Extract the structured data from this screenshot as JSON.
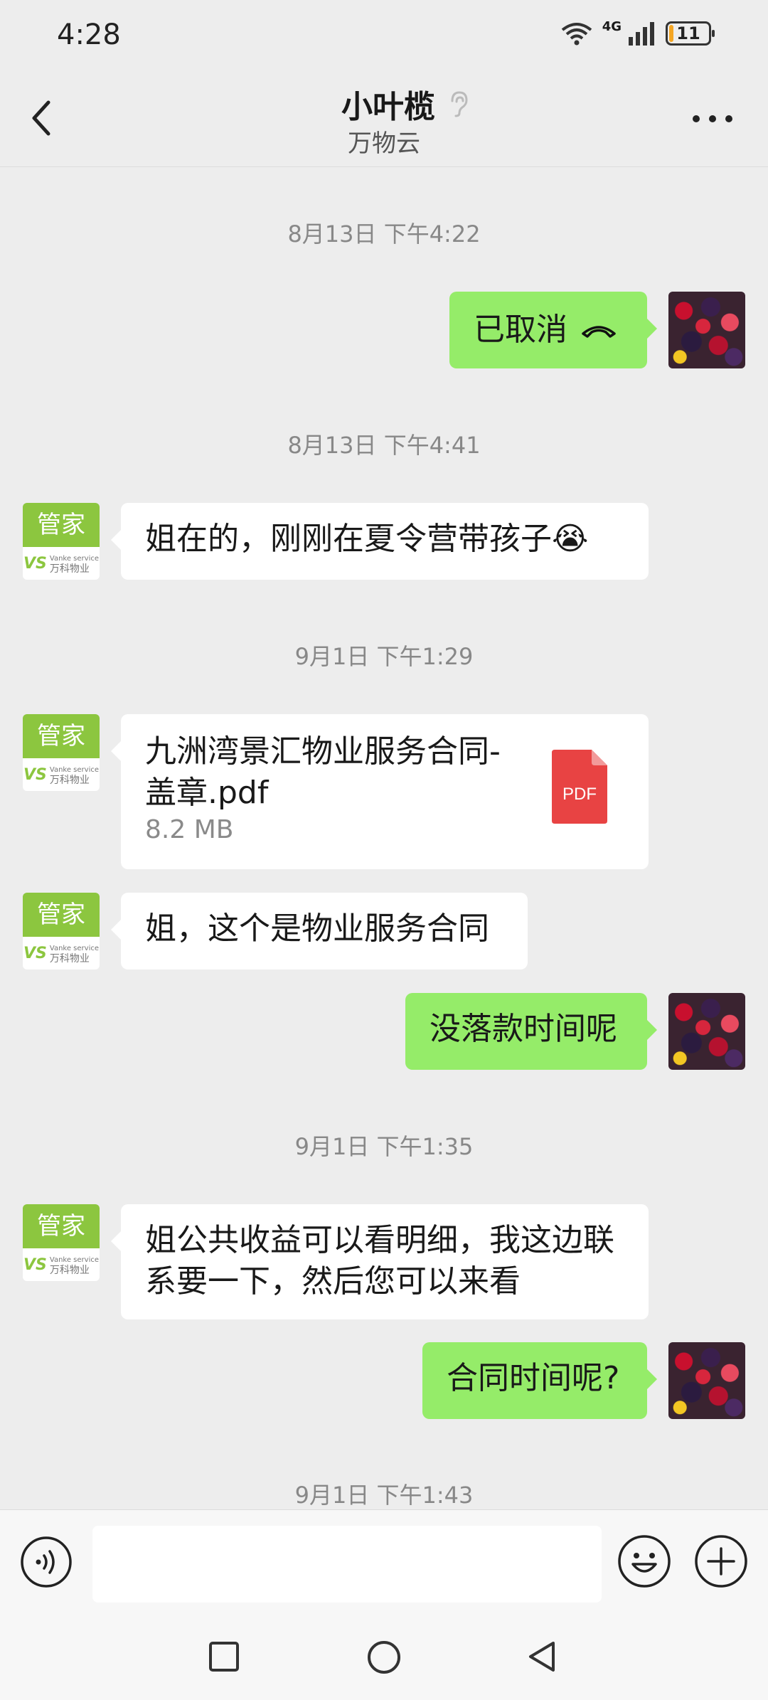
{
  "status_bar": {
    "time": "4:28",
    "network": "4G",
    "battery": "11",
    "battery_level": 0.11
  },
  "header": {
    "title": "小叶榄",
    "subtitle": "万物云"
  },
  "bot_avatar": {
    "label": "管家",
    "logo_mark": "VS",
    "logo_small": "Vanke service",
    "logo_name": "万科物业"
  },
  "messages": {
    "ts1": "8月13日 下午4:22",
    "m1": "已取消",
    "ts2": "8月13日 下午4:41",
    "m2": "姐在的，刚刚在夏令营带孩子😭",
    "ts3": "9月1日 下午1:29",
    "file": {
      "name": "九洲湾景汇物业服务合同-盖章.pdf",
      "size": "8.2 MB",
      "type_label": "PDF"
    },
    "m4": "姐，这个是物业服务合同",
    "m5": "没落款时间呢",
    "ts4": "9月1日 下午1:35",
    "m6": "姐公共收益可以看明细，我这边联系要一下，然后您可以来看",
    "m7": "合同时间呢?",
    "ts5": "9月1日 下午1:43"
  },
  "input": {
    "placeholder": ""
  },
  "icons": {
    "back": "back-arrow-icon",
    "ear": "ear-icon",
    "more": "more-dots-icon",
    "call": "hangup-phone-icon",
    "voice": "voice-icon",
    "emoji": "emoji-icon",
    "plus": "plus-icon",
    "nav_recent": "square-icon",
    "nav_home": "circle-icon",
    "nav_back": "triangle-back-icon"
  },
  "colors": {
    "bubble_me": "#95ec69",
    "bubble_other": "#ffffff",
    "background": "#ededed",
    "vanke_green": "#8cc63f",
    "pdf_red": "#e84343"
  }
}
